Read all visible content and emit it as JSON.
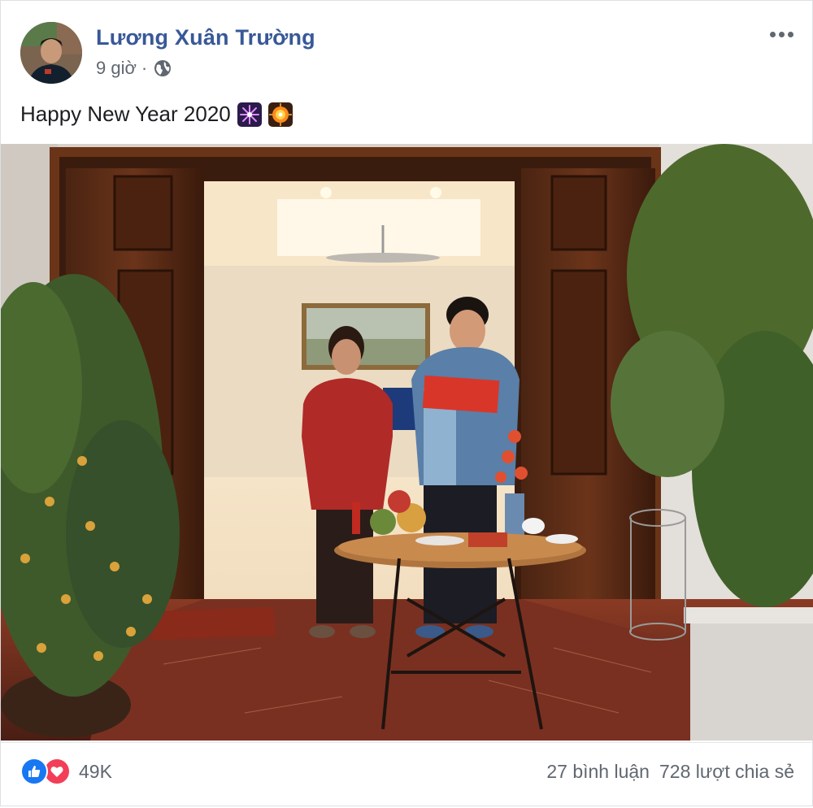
{
  "post": {
    "author": "Lương Xuân Trường",
    "time": "9 giờ",
    "separator": "·",
    "privacy_icon": "globe-icon",
    "more_icon": "more-options-icon",
    "text": "Happy New Year 2020",
    "emojis": [
      "fireworks-emoji",
      "sparkler-emoji"
    ]
  },
  "footer": {
    "reaction_icons": [
      "like-icon",
      "love-icon"
    ],
    "reaction_count": "49K",
    "comments": "27 bình luận",
    "shares": "728 lượt chia sẻ"
  },
  "colors": {
    "author": "#385898",
    "meta": "#606770",
    "like": "#1877f2",
    "love": "#f33e58"
  }
}
